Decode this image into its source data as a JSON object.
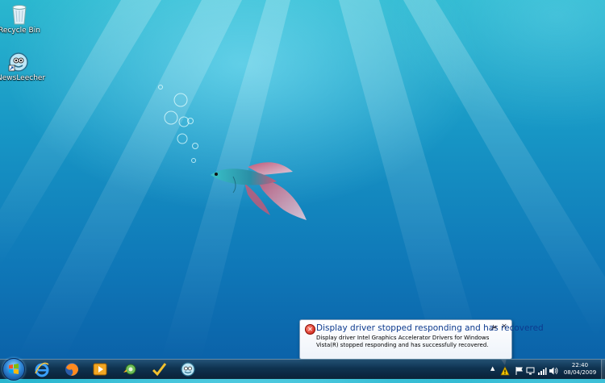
{
  "desktop": {
    "icons": [
      {
        "name": "recycle-bin",
        "label": "Recycle Bin"
      },
      {
        "name": "newsleecher",
        "label": "NewsLeecher"
      }
    ]
  },
  "notification": {
    "title": "Display driver stopped responding and has recovered",
    "body": "Display driver Intel Graphics Accelerator Drivers for Windows Vista(R) stopped responding and has successfully recovered.",
    "close_glyph": "×",
    "options_glyph": "🔧"
  },
  "taskbar": {
    "pinned": [
      "internet-explorer",
      "firefox",
      "media-player",
      "newsleecher-gear",
      "checkmark-app",
      "newsleecher"
    ],
    "tray_arrow": "▲",
    "clock": {
      "time": "22:40",
      "date": "08/04/2009"
    }
  },
  "colors": {
    "balloon_title": "#0d3a8e",
    "desktop_top": "#2ab7cf",
    "desktop_bottom": "#0a5ea6"
  }
}
